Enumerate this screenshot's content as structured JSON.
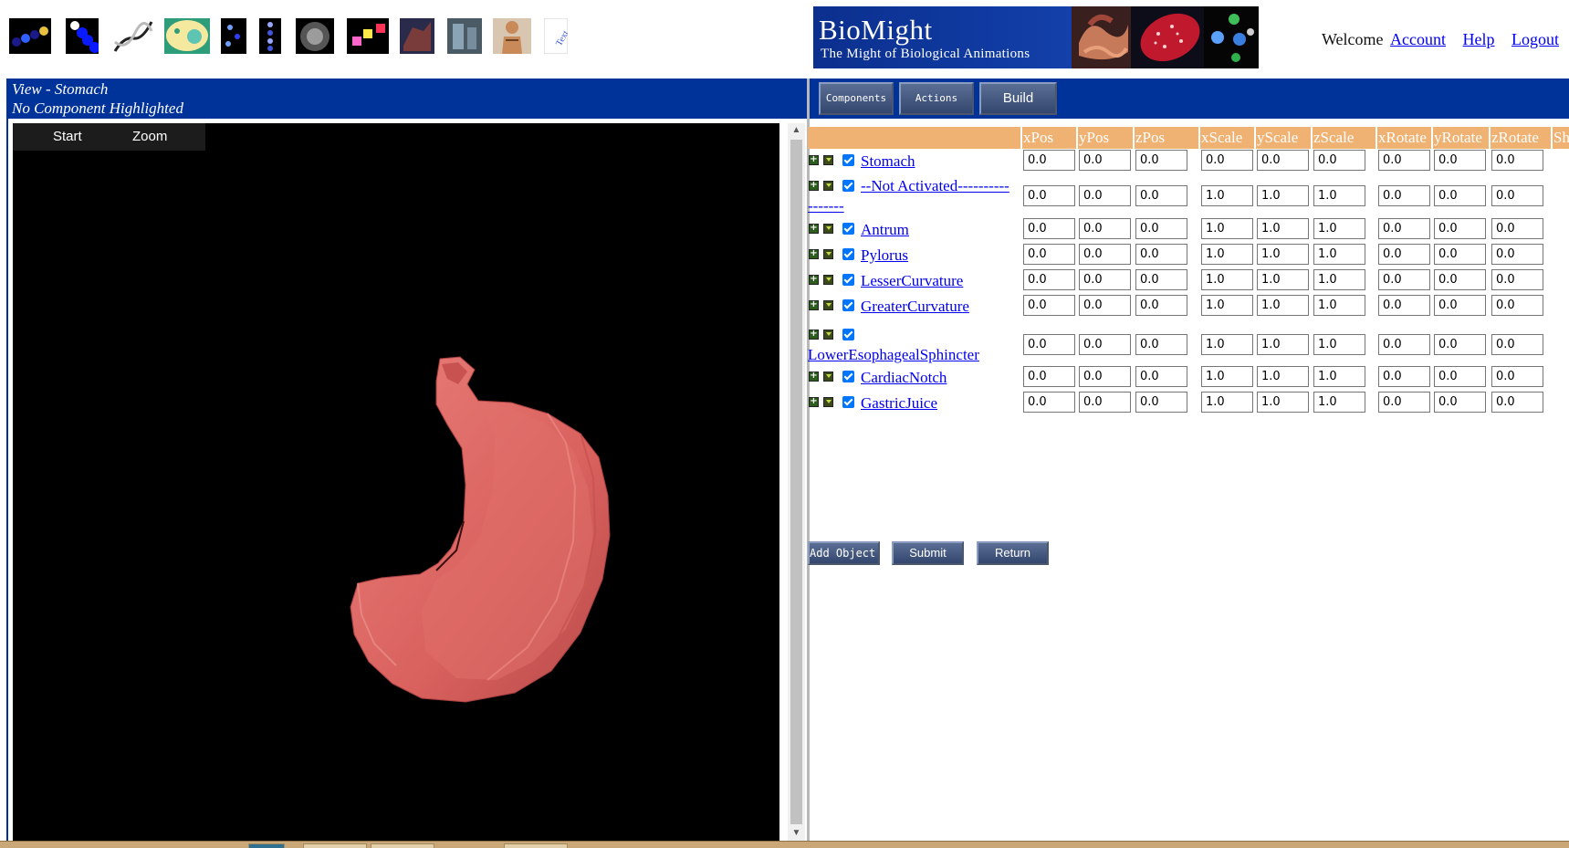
{
  "toolbar": {
    "icons": [
      {
        "name": "molecule-chain-icon",
        "colors": [
          "#1a1a8a",
          "#e8c040",
          "#3060ff"
        ]
      },
      {
        "name": "blue-cells-icon",
        "colors": [
          "#0a1aff",
          "#ffffff"
        ]
      },
      {
        "name": "dna-helix-icon",
        "colors": [
          "#bbbbbb",
          "#222222"
        ]
      },
      {
        "name": "cell-icon",
        "colors": [
          "#f5e9a0",
          "#5ec4b4",
          "#2e9d7a"
        ]
      },
      {
        "name": "particles-icon",
        "colors": [
          "#6fa0ff",
          "#2f3fff"
        ]
      },
      {
        "name": "dots-column-icon",
        "colors": [
          "#9aa6ff",
          "#4455dd"
        ]
      },
      {
        "name": "sphere-icon",
        "colors": [
          "#cccccc",
          "#555555"
        ]
      },
      {
        "name": "colored-blocks-icon",
        "colors": [
          "#ff3355",
          "#ffe84a",
          "#ff66cc"
        ]
      },
      {
        "name": "organ-scene-icon",
        "colors": [
          "#7a3b3b",
          "#2a2a4a"
        ]
      },
      {
        "name": "room-scene-icon",
        "colors": [
          "#8aa3b5",
          "#4a5b66"
        ]
      },
      {
        "name": "human-body-icon",
        "colors": [
          "#c98a5a",
          "#6a3f22"
        ]
      },
      {
        "name": "text-icon",
        "label": "Text",
        "colors": [
          "#3355cc",
          "#ffffff"
        ]
      }
    ]
  },
  "banner": {
    "title": "BioMight",
    "tagline": "The Might of Biological Animations"
  },
  "user": {
    "welcome": "Welcome",
    "account_link": "Account",
    "help_link": "Help",
    "logout_link": "Logout"
  },
  "view_header": {
    "view_title": "View - Stomach",
    "highlight_status": "No Component Highlighted"
  },
  "menu": {
    "components_label": "Components",
    "actions_label": "Actions",
    "build_label": "Build"
  },
  "viewer": {
    "start_label": "Start",
    "zoom_label": "Zoom",
    "model_color": "#d9615e"
  },
  "table": {
    "columns": [
      "xPos",
      "yPos",
      "zPos",
      "xScale",
      "yScale",
      "zScale",
      "xRotate",
      "yRotate",
      "zRotate",
      "Sh"
    ],
    "rows": [
      {
        "name": "Stomach",
        "checked": true,
        "values": [
          "0.0",
          "0.0",
          "0.0",
          "0.0",
          "0.0",
          "0.0",
          "0.0",
          "0.0",
          "0.0"
        ]
      },
      {
        "name": "--Not Activated-----------------",
        "name_line1": "--Not Activated----------",
        "name_line2": "-------",
        "checked": true,
        "values": [
          "0.0",
          "0.0",
          "0.0",
          "1.0",
          "1.0",
          "1.0",
          "0.0",
          "0.0",
          "0.0"
        ]
      },
      {
        "name": "Antrum",
        "checked": true,
        "values": [
          "0.0",
          "0.0",
          "0.0",
          "1.0",
          "1.0",
          "1.0",
          "0.0",
          "0.0",
          "0.0"
        ]
      },
      {
        "name": "Pylorus",
        "checked": true,
        "values": [
          "0.0",
          "0.0",
          "0.0",
          "1.0",
          "1.0",
          "1.0",
          "0.0",
          "0.0",
          "0.0"
        ]
      },
      {
        "name": "LesserCurvature",
        "checked": true,
        "values": [
          "0.0",
          "0.0",
          "0.0",
          "1.0",
          "1.0",
          "1.0",
          "0.0",
          "0.0",
          "0.0"
        ]
      },
      {
        "name": "GreaterCurvature",
        "checked": true,
        "values": [
          "0.0",
          "0.0",
          "0.0",
          "1.0",
          "1.0",
          "1.0",
          "0.0",
          "0.0",
          "0.0"
        ]
      },
      {
        "name": "LowerEsophagealSphincter",
        "checked": true,
        "values": [
          "0.0",
          "0.0",
          "0.0",
          "1.0",
          "1.0",
          "1.0",
          "0.0",
          "0.0",
          "0.0"
        ]
      },
      {
        "name": "CardiacNotch",
        "checked": true,
        "values": [
          "0.0",
          "0.0",
          "0.0",
          "1.0",
          "1.0",
          "1.0",
          "0.0",
          "0.0",
          "0.0"
        ]
      },
      {
        "name": "GastricJuice",
        "checked": true,
        "values": [
          "0.0",
          "0.0",
          "0.0",
          "1.0",
          "1.0",
          "1.0",
          "0.0",
          "0.0",
          "0.0"
        ]
      }
    ],
    "add_object_label": "Add Object",
    "submit_label": "Submit",
    "return_label": "Return"
  },
  "colors": {
    "header_blue": "#003399",
    "table_header": "#f0b273",
    "link": "#0000ee",
    "checkbox": "#0075ff"
  }
}
